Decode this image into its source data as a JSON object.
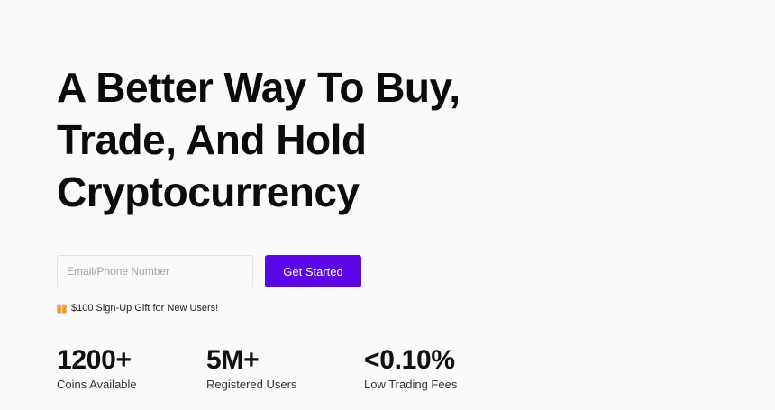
{
  "hero": {
    "headline_lines": [
      "A Better Way To Buy,",
      "Trade, And Hold",
      "Cryptocurrency"
    ]
  },
  "signup": {
    "placeholder": "Email/Phone Number",
    "button_label": "Get Started"
  },
  "gift": {
    "icon": "gift-icon",
    "text": "$100 Sign-Up Gift for New Users!"
  },
  "stats": [
    {
      "value": "1200+",
      "label": "Coins Available"
    },
    {
      "value": "5M+",
      "label": "Registered Users"
    },
    {
      "value": "<0.10%",
      "label": "Low Trading Fees"
    }
  ],
  "colors": {
    "accent": "#5a06e6",
    "background": "#fafafa",
    "gift_icon": "#f0922a"
  }
}
